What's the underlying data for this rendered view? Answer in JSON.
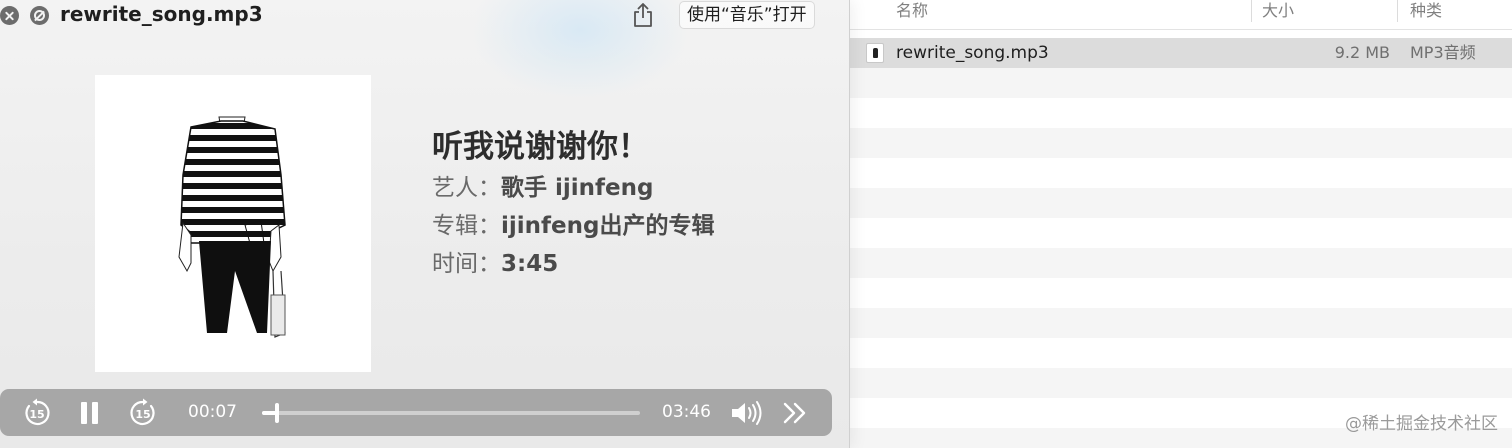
{
  "quicklook": {
    "title": "rewrite_song.mp3",
    "open_with_label": "使用“音乐”打开",
    "song_title": "听我说谢谢你！",
    "artist_label": "艺人：",
    "artist_value": "歌手 ijinfeng",
    "album_label": "专辑：",
    "album_value": "ijinfeng出产的专辑",
    "duration_label": "时间：",
    "duration_value": "3:45",
    "controls": {
      "skip_back_seconds": "15",
      "skip_forward_seconds": "15",
      "elapsed": "00:07",
      "remaining": "03:46",
      "progress_fraction": 0.04
    }
  },
  "finder": {
    "columns": {
      "name": "名称",
      "size": "大小",
      "kind": "种类"
    },
    "files": [
      {
        "name": "rewrite_song.mp3",
        "size": "9.2 MB",
        "kind": "MP3音频",
        "selected": true
      }
    ]
  },
  "watermark": "@稀土掘金技术社区",
  "icons": {
    "close": "close-icon",
    "fullscreen": "fullscreen-icon",
    "share": "share-icon",
    "skip_back": "skip-back-15-icon",
    "pause": "pause-icon",
    "skip_forward": "skip-forward-15-icon",
    "volume": "volume-icon",
    "more": "chevrons-right-icon"
  }
}
